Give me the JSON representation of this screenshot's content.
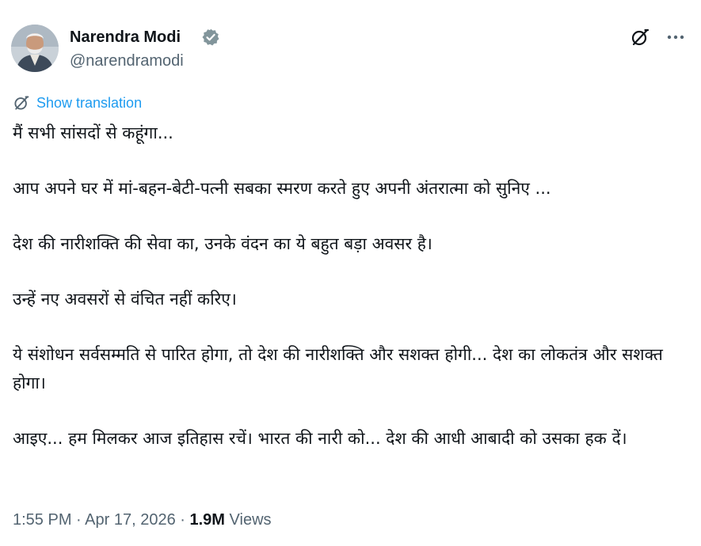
{
  "author": {
    "display_name": "Narendra Modi",
    "handle": "@narendramodi",
    "verified": true
  },
  "icons": {
    "verified": "verified-badge-icon",
    "grok": "grok-icon",
    "more": "more-options-icon",
    "translate": "translate-icon"
  },
  "colors": {
    "link": "#1d9bf0",
    "secondary_text": "#536471",
    "primary_text": "#0f1419"
  },
  "translation_link": "Show translation",
  "paragraphs": [
    "मैं सभी सांसदों से कहूंगा...",
    "आप अपने घर में मां-बहन-बेटी-पत्नी सबका स्मरण करते हुए अपनी अंतरात्मा को सुनिए ...",
    "देश की नारीशक्ति की सेवा का, उनके वंदन का ये बहुत बड़ा अवसर है।",
    "उन्हें नए अवसरों से वंचित नहीं करिए।",
    "ये संशोधन सर्वसम्मति से पारित होगा, तो देश की नारीशक्ति और सशक्त होगी... देश का लोकतंत्र और सशक्त होगा।",
    "आइए... हम मिलकर आज इतिहास रचें। भारत की नारी को... देश की आधी आबादी को उसका हक दें।"
  ],
  "meta": {
    "time": "1:55 PM",
    "separator": "·",
    "date": "Apr 17, 2026",
    "views_count": "1.9M",
    "views_label": "Views"
  }
}
